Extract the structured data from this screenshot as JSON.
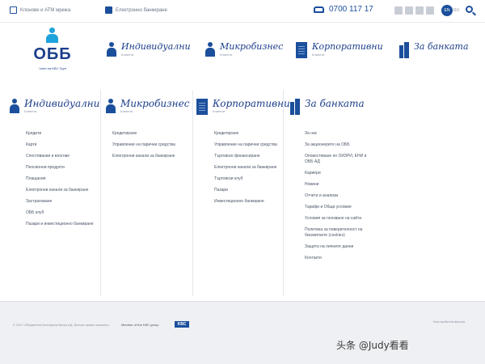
{
  "topbar": {
    "locator_label": "Клонове и ATM мрежа",
    "ebanking_label": "Електронно банкиране",
    "phone": "0700 117 17",
    "lang_active": "EN",
    "lang_other": "RU",
    "social": [
      "blog-icon",
      "linkedin-icon",
      "youtube-icon",
      "facebook-icon"
    ]
  },
  "logo": {
    "text": "ОББ",
    "tagline": "Член на KBC Груп"
  },
  "main_nav": [
    {
      "title": "Индивидуални",
      "sub": "Клиенти"
    },
    {
      "title": "Микробизнес",
      "sub": "Клиенти"
    },
    {
      "title": "Корпоративни",
      "sub": "Клиенти"
    },
    {
      "title": "За банката",
      "sub": ""
    }
  ],
  "mega": {
    "individual": {
      "title": "Индивидуални",
      "sub": "Клиенти",
      "links": [
        "Кредити",
        "Карти",
        "Спестявания и влогове",
        "Пенсионни продукти",
        "Плащания",
        "Електронни канали за банкиране",
        "Застраховане",
        "ОББ клуб",
        "Пазари и инвестиционно банкиране"
      ]
    },
    "micro": {
      "title": "Микробизнес",
      "sub": "Клиенти",
      "links": [
        "Кредитиране",
        "Управление на парични средства",
        "Електронни канали за банкиране"
      ]
    },
    "corporate": {
      "title": "Корпоративни",
      "sub": "Клиенти",
      "links": [
        "Кредитиране",
        "Управление на парични средства",
        "Търговско финансиране",
        "Електронни канали за банкиране",
        "Търговски клуб",
        "Пазари",
        "Инвестиционно банкиране"
      ]
    },
    "about": {
      "title": "За банката",
      "links": [
        "За нас",
        "За акционерите на ОББ",
        "Оповестяване по ОИЗРИ, ЕНИ и ОББ АД",
        "Кариери",
        "Новини",
        "Отчети и анализи",
        "Тарифи и Общи условия",
        "Условия за ползване на сайта",
        "Политика за поверителност на бисквитките (cookies)",
        "Защита на личните данни",
        "Контакти"
      ]
    }
  },
  "footer": {
    "copyright": "© 2017 Обединена българска банка АД. Всички права запазени",
    "member": "Member of the KBC group",
    "kbc": "KBC",
    "right": "Към мобилна версия"
  },
  "watermark": "头条 @Judy看看"
}
